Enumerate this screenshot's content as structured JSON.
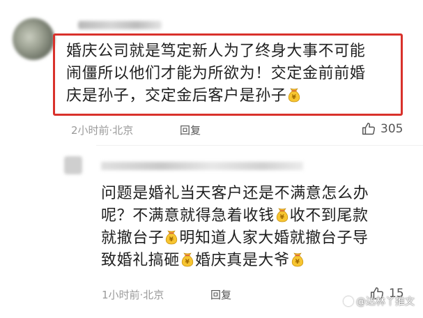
{
  "comments": [
    {
      "lines": [
        [
          "婚庆公司就是笃定新人为了终身大事不可能"
        ],
        [
          "闹僵所以他们才能为所欲为！交定金前前婚"
        ],
        [
          "庆是孙子，交定金后客户是孙子",
          "emoji"
        ]
      ],
      "time_location": "2小时前·北京",
      "reply_label": "回复",
      "likes": "305",
      "highlighted": true
    },
    {
      "lines": [
        [
          "问题是婚礼当天客户还是不满意怎么办"
        ],
        [
          "呢？不满意就得急着收钱",
          "emoji",
          "收不到尾款"
        ],
        [
          "就撤台子",
          "emoji",
          "明知道人家大婚就撤台子导"
        ],
        [
          "致婚礼搞砸",
          "emoji",
          "婚庆真是大爷",
          "emoji"
        ]
      ],
      "time_location": "1小时前·北京",
      "reply_label": "回复",
      "likes": "15",
      "highlighted": false
    }
  ],
  "watermark": "@达林丫推文",
  "colors": {
    "highlight_border": "#d9312b",
    "meta_text": "#9a9a9a"
  },
  "icons": {
    "emoji": "money-bag-emoji",
    "like": "thumbs-up-icon"
  }
}
